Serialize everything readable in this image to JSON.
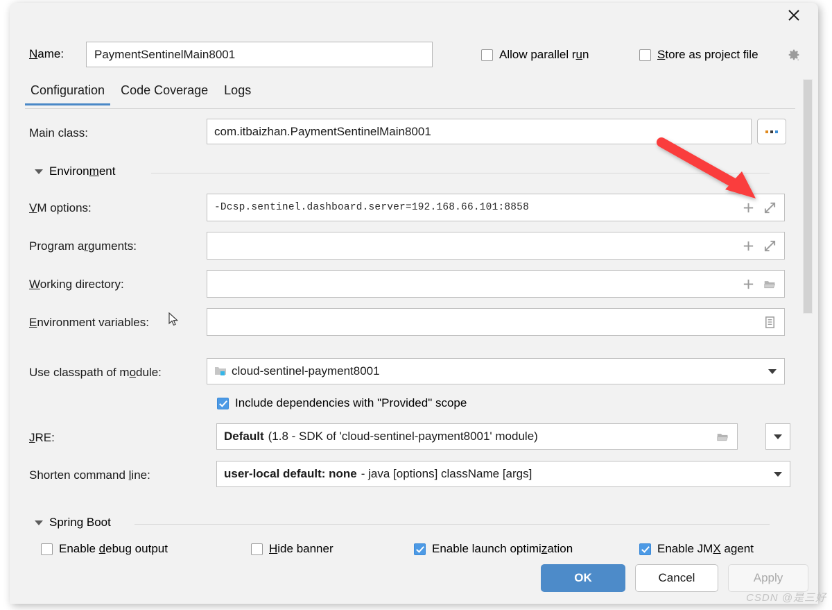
{
  "window": {
    "close_icon": "close-icon",
    "gear_icon": "gear-icon"
  },
  "name_row": {
    "label": "Name:",
    "label_mnemonic": "N",
    "value": "PaymentSentinelMain8001",
    "allow_parallel_run": {
      "label": "Allow parallel run",
      "mnemonic": "u",
      "checked": false
    },
    "store_as_project_file": {
      "label": "Store as project file",
      "mnemonic": "S",
      "checked": false
    }
  },
  "tabs": [
    {
      "label": "Configuration",
      "active": true
    },
    {
      "label": "Code Coverage",
      "active": false
    },
    {
      "label": "Logs",
      "active": false
    }
  ],
  "fields": {
    "main_class": {
      "label": "Main class:",
      "value": "com.itbaizhan.PaymentSentinelMain8001",
      "browse_button": "..."
    },
    "environment_group": {
      "label": "Environment",
      "mnemonic": "m",
      "expanded": true
    },
    "vm_options": {
      "label": "VM options:",
      "mnemonic": "V",
      "value": "-Dcsp.sentinel.dashboard.server=192.168.66.101:8858",
      "icons": [
        "plus-icon",
        "expand-icon"
      ]
    },
    "program_arguments": {
      "label": "Program arguments:",
      "mnemonic": "r",
      "value": "",
      "icons": [
        "plus-icon",
        "expand-icon"
      ]
    },
    "working_directory": {
      "label": "Working directory:",
      "mnemonic": "W",
      "value": "",
      "icons": [
        "plus-icon",
        "folder-icon"
      ]
    },
    "environment_variables": {
      "label": "Environment variables:",
      "mnemonic": "E",
      "value": "",
      "icons": [
        "list-icon"
      ]
    },
    "use_classpath_of_module": {
      "label": "Use classpath of module:",
      "mnemonic": "o",
      "value": "cloud-sentinel-payment8001",
      "icon": "module-icon"
    },
    "include_provided": {
      "label": "Include dependencies with \"Provided\" scope",
      "checked": true
    },
    "jre": {
      "label": "JRE:",
      "mnemonic": "J",
      "value_bold": "Default",
      "value_muted": "(1.8 - SDK of 'cloud-sentinel-payment8001' module)",
      "icons": [
        "folder-icon",
        "chevron-down-icon"
      ]
    },
    "shorten_command_line": {
      "label": "Shorten command line:",
      "mnemonic": "l",
      "value_bold": "user-local default: none",
      "value_muted": "- java [options] className [args]",
      "icons": [
        "chevron-down-icon"
      ]
    }
  },
  "spring_boot": {
    "group_label": "Spring Boot",
    "mnemonic": "g",
    "expanded": true,
    "checkboxes": [
      {
        "label": "Enable debug output",
        "mnemonic": "d",
        "checked": false
      },
      {
        "label": "Hide banner",
        "mnemonic": "H",
        "checked": false
      },
      {
        "label": "Enable launch optimization",
        "mnemonic": "z",
        "checked": true
      },
      {
        "label": "Enable JMX agent",
        "mnemonic": "X",
        "checked": true
      }
    ]
  },
  "buttons": {
    "ok": "OK",
    "cancel": "Cancel",
    "apply": "Apply",
    "apply_disabled": true
  },
  "annotations": {
    "arrow_color": "#fa3c3c"
  },
  "watermark": "CSDN @是三好"
}
